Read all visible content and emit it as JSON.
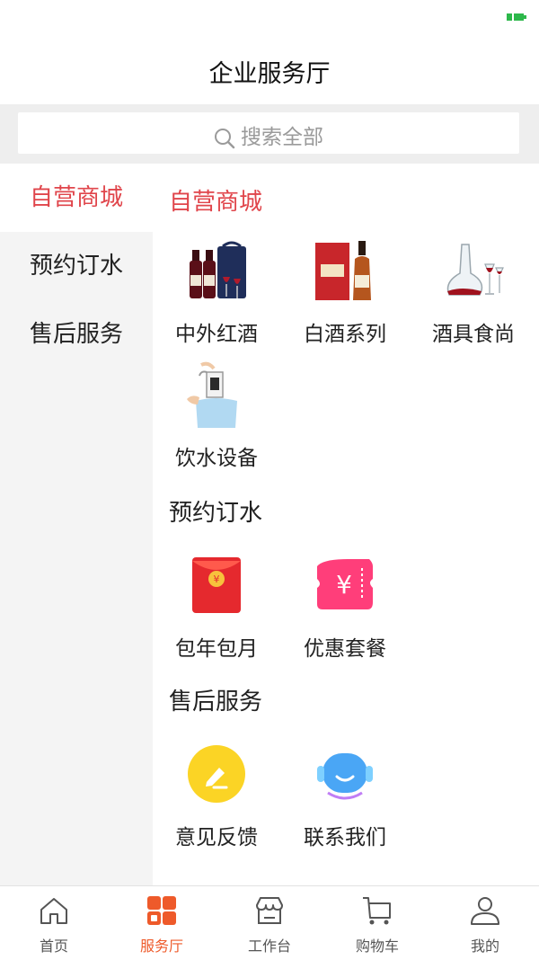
{
  "header": {
    "title": "企业服务厅"
  },
  "search": {
    "placeholder": "搜索全部"
  },
  "sidebar": {
    "items": [
      {
        "label": "自营商城",
        "active": true
      },
      {
        "label": "预约订水",
        "active": false
      },
      {
        "label": "售后服务",
        "active": false
      }
    ]
  },
  "sections": [
    {
      "title": "自营商城",
      "items": [
        {
          "label": "中外红酒",
          "icon": "red-wine-icon"
        },
        {
          "label": "白酒系列",
          "icon": "liquor-bottle-icon"
        },
        {
          "label": "酒具食尚",
          "icon": "decanter-icon"
        },
        {
          "label": "饮水设备",
          "icon": "water-dispenser-icon"
        }
      ]
    },
    {
      "title": "预约订水",
      "items": [
        {
          "label": "包年包月",
          "icon": "red-envelope-icon"
        },
        {
          "label": "优惠套餐",
          "icon": "coupon-icon"
        }
      ]
    },
    {
      "title": "售后服务",
      "items": [
        {
          "label": "意见反馈",
          "icon": "feedback-icon"
        },
        {
          "label": "联系我们",
          "icon": "customer-service-icon"
        }
      ]
    }
  ],
  "tabbar": {
    "tabs": [
      {
        "label": "首页",
        "icon": "home-icon"
      },
      {
        "label": "服务厅",
        "icon": "service-grid-icon",
        "active": true
      },
      {
        "label": "工作台",
        "icon": "store-icon"
      },
      {
        "label": "购物车",
        "icon": "cart-icon"
      },
      {
        "label": "我的",
        "icon": "user-icon"
      }
    ]
  },
  "colors": {
    "accent": "#e0454b",
    "tab_active": "#ee5a2a",
    "sidebar_bg": "#f4f4f4"
  }
}
